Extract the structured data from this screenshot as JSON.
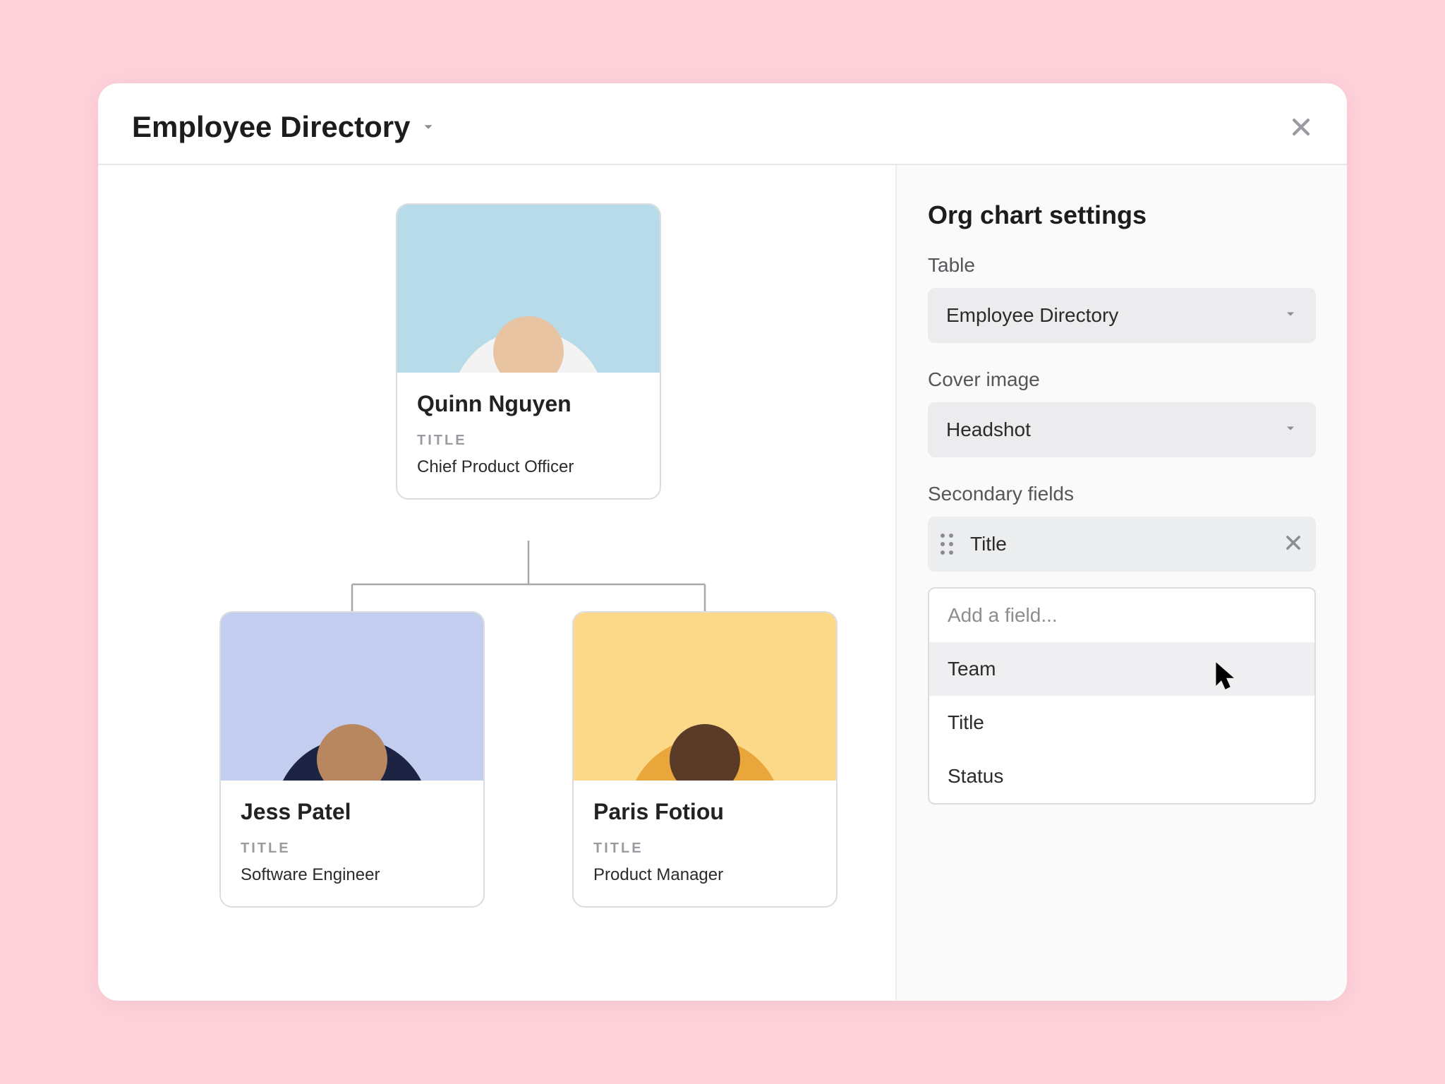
{
  "title": "Employee Directory",
  "org": {
    "root": {
      "name": "Quinn Nguyen",
      "field_label": "TITLE",
      "title": "Chief Product Officer",
      "photo_bg": "#b7dbe8"
    },
    "children": [
      {
        "name": "Jess Patel",
        "field_label": "TITLE",
        "title": "Software Engineer",
        "photo_bg": "#c3cdef",
        "shirt": "#1d2342"
      },
      {
        "name": "Paris Fotiou",
        "field_label": "TITLE",
        "title": "Product Manager",
        "photo_bg": "#fbd989",
        "shirt": "#e9a63a"
      }
    ]
  },
  "settings": {
    "title": "Org chart settings",
    "table_label": "Table",
    "table_value": "Employee Directory",
    "cover_label": "Cover image",
    "cover_value": "Headshot",
    "secondary_label": "Secondary fields",
    "secondary_chip": "Title",
    "add_placeholder": "Add a field...",
    "options": [
      "Team",
      "Title",
      "Status"
    ]
  }
}
